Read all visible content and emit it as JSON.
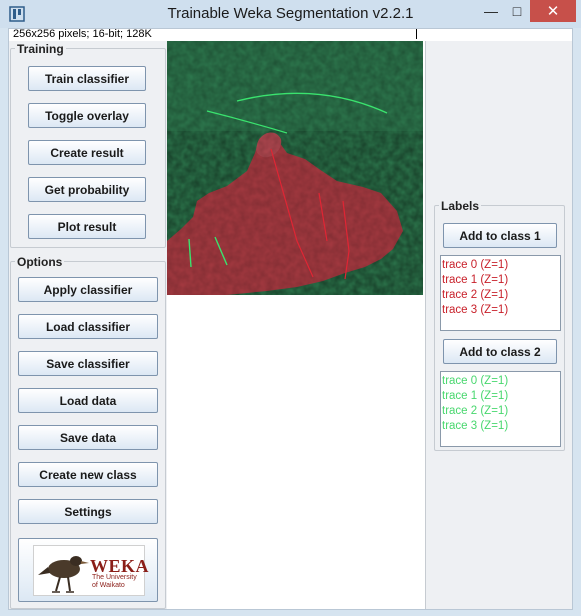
{
  "window": {
    "title": "Trainable Weka Segmentation v2.2.1",
    "minimize_glyph": "—",
    "maximize_glyph": "□",
    "close_glyph": "✕",
    "icon": "imagej-icon",
    "title_bar_color": "#cfdfee",
    "close_button_color": "#c7504a"
  },
  "status": {
    "text": "256x256 pixels; 16-bit; 128K"
  },
  "training": {
    "title": "Training",
    "buttons": [
      "Train classifier",
      "Toggle overlay",
      "Create result",
      "Get probability",
      "Plot result"
    ]
  },
  "options": {
    "title": "Options",
    "buttons": [
      "Apply classifier",
      "Load classifier",
      "Save classifier",
      "Load data",
      "Save data",
      "Create new class",
      "Settings"
    ],
    "logo": {
      "word": "WEKA",
      "line1": "The University",
      "line2": "of Waikato",
      "icon": "weka-bird-icon"
    }
  },
  "labels": {
    "title": "Labels",
    "class1": {
      "button": "Add to class 1",
      "color": "#c8202a",
      "traces": [
        "trace 0 (Z=1)",
        "trace 1 (Z=1)",
        "trace 2 (Z=1)",
        "trace 3 (Z=1)"
      ]
    },
    "class2": {
      "button": "Add to class 2",
      "color": "#48d76e",
      "traces": [
        "trace 0 (Z=1)",
        "trace 1 (Z=1)",
        "trace 2 (Z=1)",
        "trace 3 (Z=1)"
      ]
    }
  },
  "overlay_colors": {
    "background": "#2e7a4f",
    "foreground": "#a53a41"
  }
}
